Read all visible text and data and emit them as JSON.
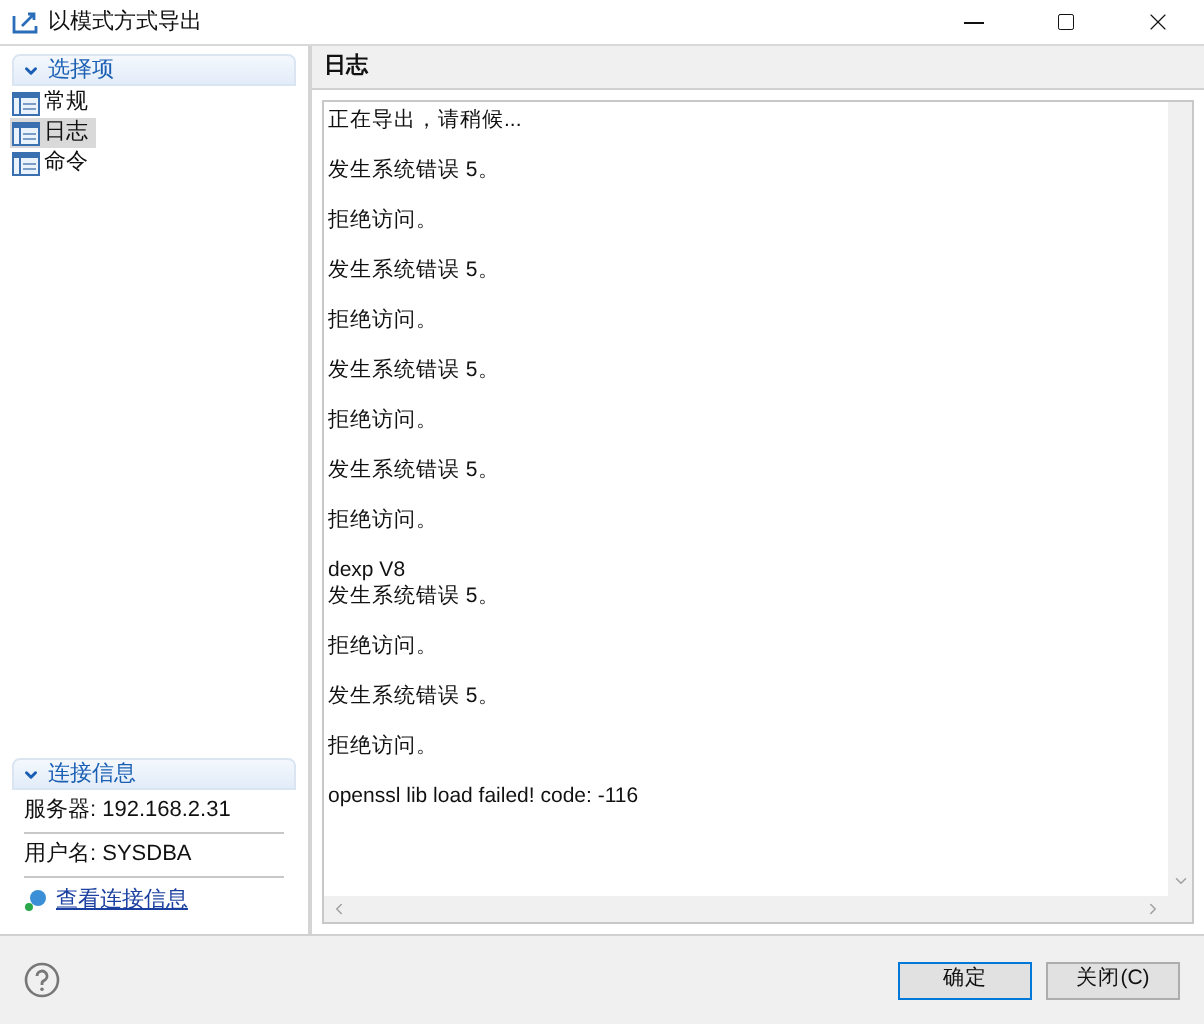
{
  "window": {
    "title": "以模式方式导出"
  },
  "sidebar": {
    "title": "选择项",
    "expanded": true,
    "items": [
      {
        "label": "常规",
        "selected": false
      },
      {
        "label": "日志",
        "selected": true
      },
      {
        "label": "命令",
        "selected": false
      }
    ]
  },
  "connection": {
    "title": "连接信息",
    "expanded": true,
    "rows": [
      "服务器: 192.168.2.31",
      "用户名: SYSDBA"
    ],
    "link": "查看连接信息"
  },
  "panel": {
    "title": "日志",
    "log": [
      [
        "正在导出，请稍候..."
      ],
      [
        "发生系统错误 5。"
      ],
      [
        "拒绝访问。"
      ],
      [
        "发生系统错误 5。"
      ],
      [
        "拒绝访问。"
      ],
      [
        "发生系统错误 5。"
      ],
      [
        "拒绝访问。"
      ],
      [
        "发生系统错误 5。"
      ],
      [
        "拒绝访问。"
      ],
      [
        "dexp V8",
        "发生系统错误 5。"
      ],
      [
        "拒绝访问。"
      ],
      [
        "发生系统错误 5。"
      ],
      [
        "拒绝访问。"
      ],
      [
        "openssl lib load failed! code: -116"
      ]
    ]
  },
  "buttons": [
    {
      "label": "确定",
      "default": true
    },
    {
      "label": "关闭(C)",
      "default": false
    }
  ]
}
